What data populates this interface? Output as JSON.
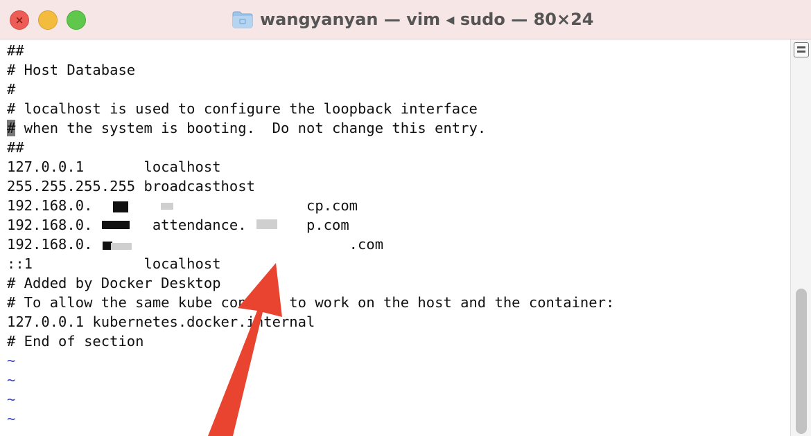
{
  "window": {
    "title": "wangyanyan — vim ◂ sudo — 80×24",
    "close_symbol": "×"
  },
  "editor": {
    "lines": [
      "##",
      "# Host Database",
      "#",
      "# localhost is used to configure the loopback interface",
      "# when the system is booting.  Do not change this entry.",
      "##",
      "127.0.0.1       localhost",
      "255.255.255.255 broadcasthost",
      "192.168.0.                         cp.com",
      "192.168.0.       attendance.       p.com",
      "192.168.0.                              .com",
      "::1             localhost",
      "# Added by Docker Desktop",
      "# To allow the same kube context to work on the host and the container:",
      "127.0.0.1 kubernetes.docker.internal",
      "# End of section",
      "~",
      "~",
      "~",
      "~"
    ],
    "cursor_line_rest": " when the system is booting.  Do not change this entry.",
    "cursor_char": "#"
  },
  "icons": {
    "folder": "folder-icon",
    "scrollbar_button": "scrollbar-menu-icon",
    "annotation": "red-arrow-icon"
  },
  "colors": {
    "titlebar": "#f6e6e6",
    "close": "#ee5d55",
    "minimize": "#f3bc3f",
    "zoom": "#5fc84c",
    "tilde": "#3b3bcf",
    "arrow": "#e94430"
  }
}
